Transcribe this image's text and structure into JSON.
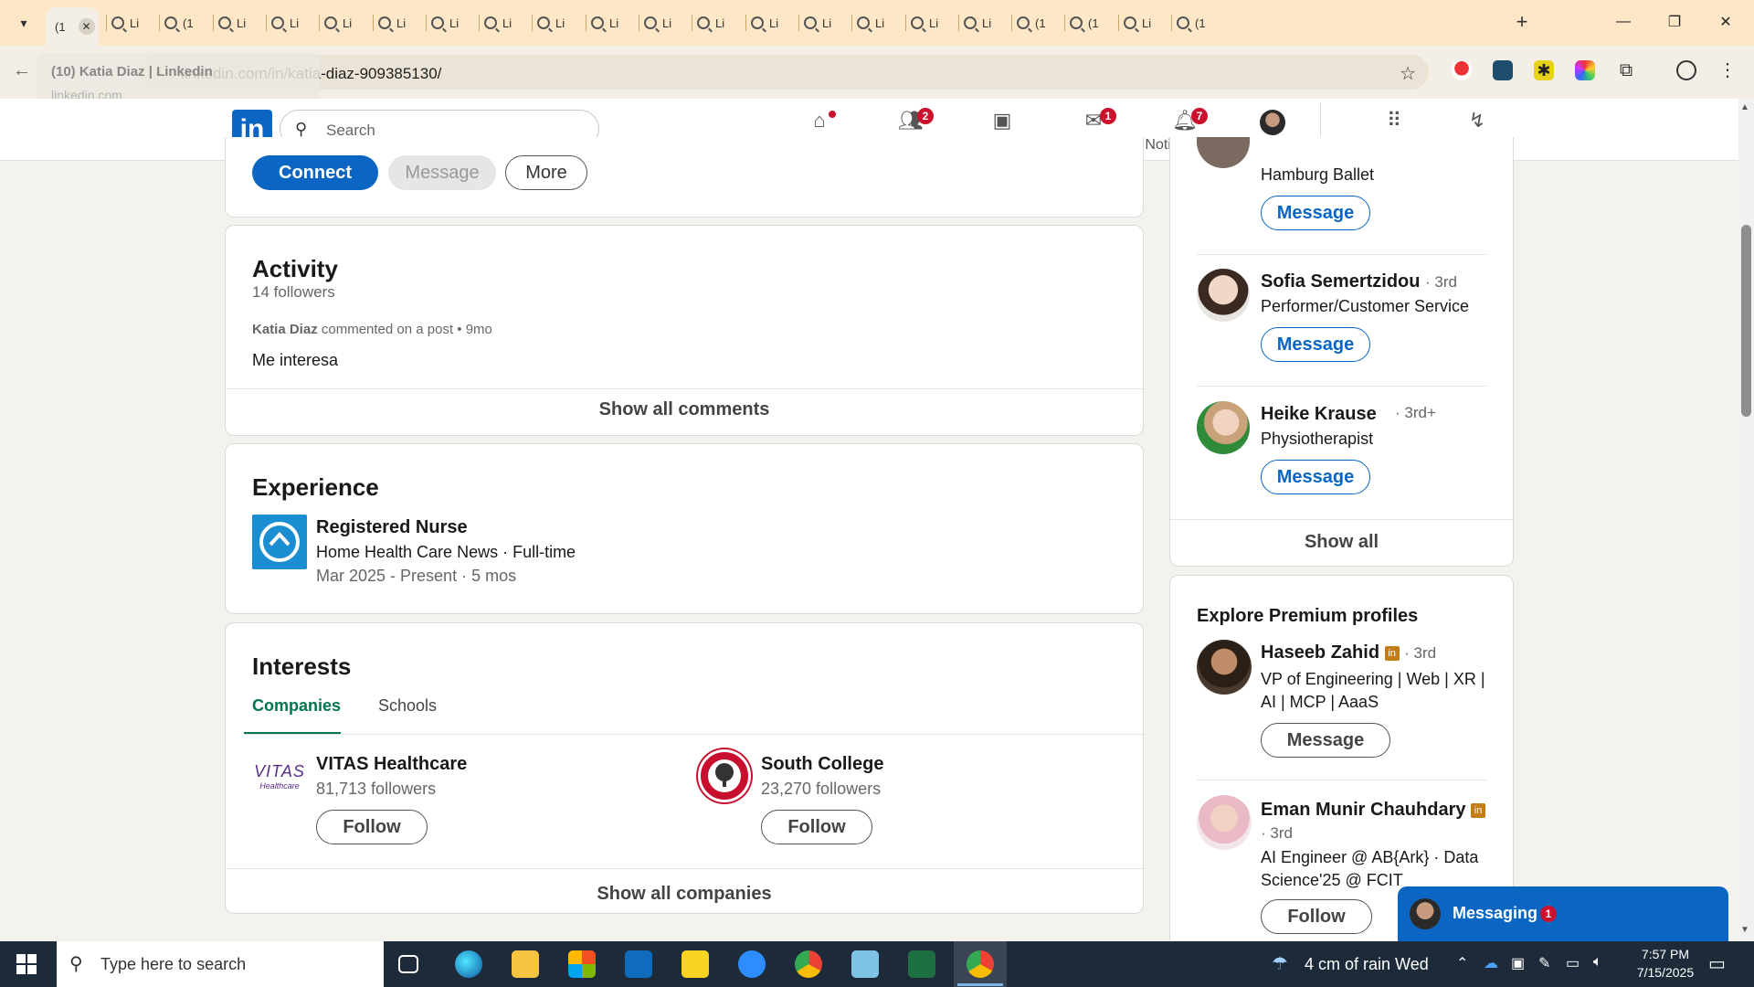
{
  "browser": {
    "active_tab_title": "(1",
    "tabs": [
      "Li",
      "(1",
      "Li",
      "Li",
      "Li",
      "Li",
      "Li",
      "Li",
      "Li",
      "Li",
      "Li",
      "Li",
      "Li",
      "Li",
      "Li",
      "Li",
      "Li",
      "(1",
      "(1",
      "Li",
      "(1"
    ],
    "url": "linkedin.com/in/katia-diaz-909385130/",
    "tooltip_title": "(10) Katia Diaz | Linkedin",
    "tooltip_domain": "linkedin.com"
  },
  "linkedin": {
    "logo": "in",
    "search_placeholder": "Search",
    "nav": [
      {
        "label": "Home",
        "icon": "home-icon",
        "badge": ""
      },
      {
        "label": "My Network",
        "icon": "network-icon",
        "badge": "2"
      },
      {
        "label": "Jobs",
        "icon": "jobs-icon",
        "badge": ""
      },
      {
        "label": "Messaging",
        "icon": "messaging-icon",
        "badge": "1"
      },
      {
        "label": "Notifications",
        "icon": "bell-icon",
        "badge": "7"
      },
      {
        "label": "Me",
        "icon": "avatar",
        "badge": ""
      },
      {
        "label": "For Business",
        "icon": "grid-icon",
        "badge": ""
      },
      {
        "label": "Advertise",
        "icon": "advertise-icon",
        "badge": ""
      }
    ]
  },
  "profile_actions": {
    "connect": "Connect",
    "message": "Message",
    "more": "More"
  },
  "activity": {
    "title": "Activity",
    "followers": "14 followers",
    "author": "Katia Diaz",
    "action": " commented on a post • 9mo",
    "comment": "Me interesa",
    "show_all": "Show all comments"
  },
  "experience": {
    "title": "Experience",
    "role": "Registered Nurse",
    "company": "Home Health Care News · Full-time",
    "dates": "Mar 2025 - Present · 5 mos"
  },
  "interests": {
    "title": "Interests",
    "tabs": [
      "Companies",
      "Schools"
    ],
    "items": [
      {
        "name": "VITAS Healthcare",
        "followers": "81,713 followers",
        "button": "Follow",
        "logo_text": "VITAS",
        "logo_sub": "Healthcare"
      },
      {
        "name": "South College",
        "followers": "23,270 followers",
        "button": "Follow"
      }
    ],
    "show_all": "Show all companies"
  },
  "sidebar_people": [
    {
      "name": "",
      "degree": "",
      "headline": "Hamburg Ballet",
      "button": "Message"
    },
    {
      "name": "Sofia Semertzidou",
      "degree": "· 3rd",
      "headline": "Performer/Customer Service",
      "button": "Message"
    },
    {
      "name": "Heike Krause",
      "degree": "· 3rd+",
      "headline": "Physiotherapist",
      "button": "Message"
    }
  ],
  "sidebar_show_all": "Show all",
  "premium": {
    "title": "Explore Premium profiles",
    "people": [
      {
        "name": "Haseeb Zahid",
        "degree": "· 3rd",
        "headline": "VP of Engineering | Web | XR | AI | MCP | AaaS",
        "button": "Message"
      },
      {
        "name": "Eman Munir Chauhdary",
        "degree": "· 3rd",
        "headline": "AI Engineer @ AB{Ark} · Data Science'25 @ FCIT",
        "button": "Follow"
      }
    ]
  },
  "messaging_widget": {
    "label": "Messaging",
    "badge": "1"
  },
  "taskbar": {
    "search_placeholder": "Type here to search",
    "weather": "4 cm of rain Wed",
    "time": "7:57 PM",
    "date": "7/15/2025"
  },
  "colors": {
    "linkedin_blue": "#0a66c2",
    "green_tab": "#01754f",
    "badge_red": "#cb112d",
    "tabstrip": "#fde7c6"
  }
}
